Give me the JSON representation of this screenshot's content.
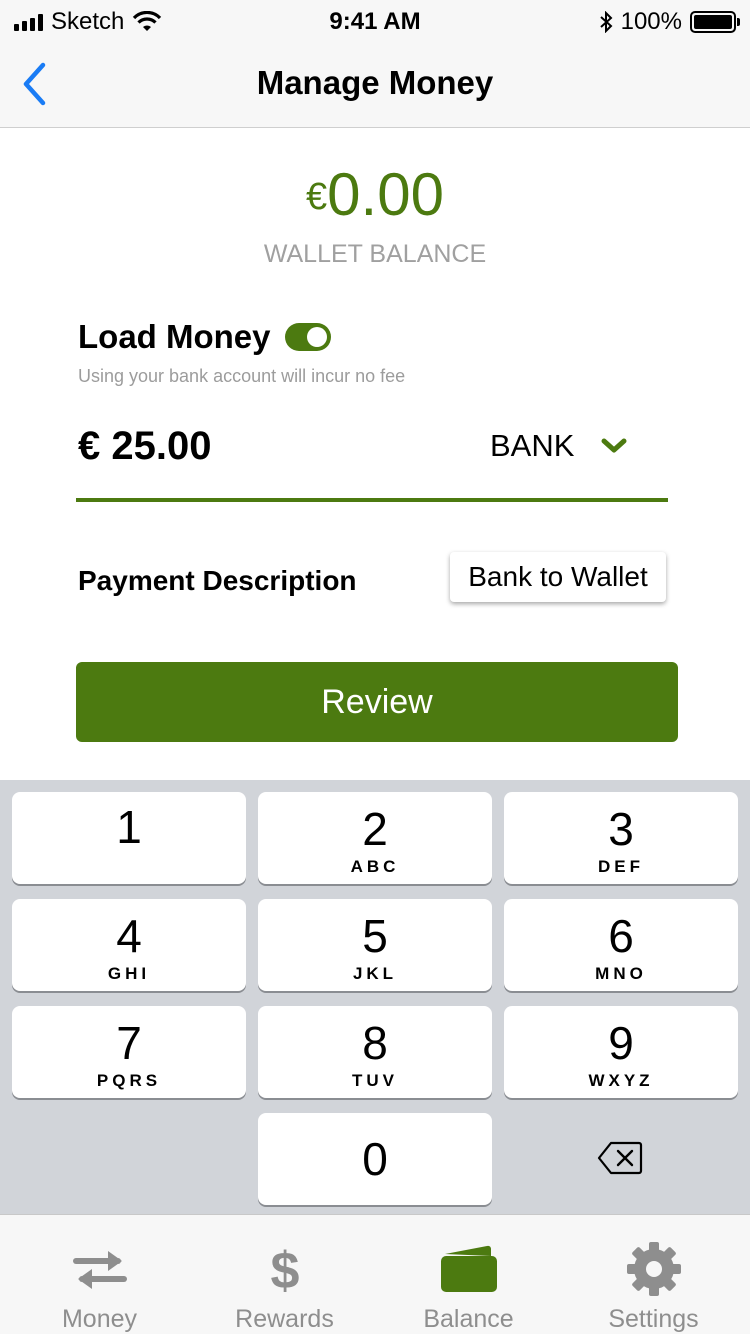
{
  "status_bar": {
    "carrier": "Sketch",
    "time": "9:41 AM",
    "battery": "100%"
  },
  "nav": {
    "title": "Manage Money"
  },
  "balance": {
    "currency": "€",
    "amount": "0.00",
    "label": "WALLET BALANCE"
  },
  "load": {
    "title": "Load Money",
    "toggle_on": true,
    "subtitle": "Using your bank account will incur no fee"
  },
  "amount": {
    "value": "€ 25.00"
  },
  "source": {
    "label": "BANK"
  },
  "payment": {
    "label": "Payment Description",
    "value": "Bank to Wallet"
  },
  "review": {
    "label": "Review"
  },
  "keypad": {
    "keys": [
      {
        "digit": "1",
        "letters": ""
      },
      {
        "digit": "2",
        "letters": "ABC"
      },
      {
        "digit": "3",
        "letters": "DEF"
      },
      {
        "digit": "4",
        "letters": "GHI"
      },
      {
        "digit": "5",
        "letters": "JKL"
      },
      {
        "digit": "6",
        "letters": "MNO"
      },
      {
        "digit": "7",
        "letters": "PQRS"
      },
      {
        "digit": "8",
        "letters": "TUV"
      },
      {
        "digit": "9",
        "letters": "WXYZ"
      },
      {
        "digit": "0",
        "letters": ""
      }
    ]
  },
  "tabs": [
    {
      "label": "Money",
      "icon": "transfer-arrows-icon"
    },
    {
      "label": "Rewards",
      "icon": "dollar-icon"
    },
    {
      "label": "Balance",
      "icon": "wallet-icon"
    },
    {
      "label": "Settings",
      "icon": "gear-icon"
    }
  ],
  "colors": {
    "accent": "#4c7a10",
    "keypad_bg": "#d1d4d9",
    "icon_grey": "#8e8e8e",
    "link_blue": "#1a7cf5"
  }
}
